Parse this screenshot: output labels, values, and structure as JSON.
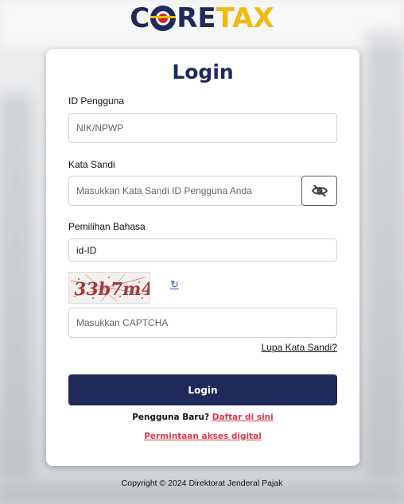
{
  "logo": {
    "part1": "C",
    "part2": "RE",
    "part3": "TAX"
  },
  "login_form": {
    "title": "Login",
    "user_id_label": "ID Pengguna",
    "user_id_placeholder": "NIK/NPWP",
    "password_label": "Kata Sandi",
    "password_placeholder": "Masukkan Kata Sandi ID Pengguna Anda",
    "language_label": "Pemilihan Bahasa",
    "language_value": "id-ID",
    "captcha_text": "33b7m4",
    "captcha_refresh_icon": "↻",
    "captcha_placeholder": "Masukkan CAPTCHA",
    "forgot_password": "Lupa Kata Sandi?",
    "login_button": "Login",
    "new_user_text": "Pengguna Baru?",
    "register_link": "Daftar di sini",
    "digital_access_link": "Permintaan akses digital"
  },
  "footer": {
    "copyright": "Copyright © 2024 Direktorat Jenderal Pajak"
  },
  "colors": {
    "brand_navy": "#1e2a5a",
    "brand_yellow": "#f2b90f",
    "brand_red": "#d7222a",
    "link_red": "#d93c4a"
  },
  "icons": {
    "toggle_password": "eye-slash-icon",
    "refresh": "refresh-icon"
  }
}
